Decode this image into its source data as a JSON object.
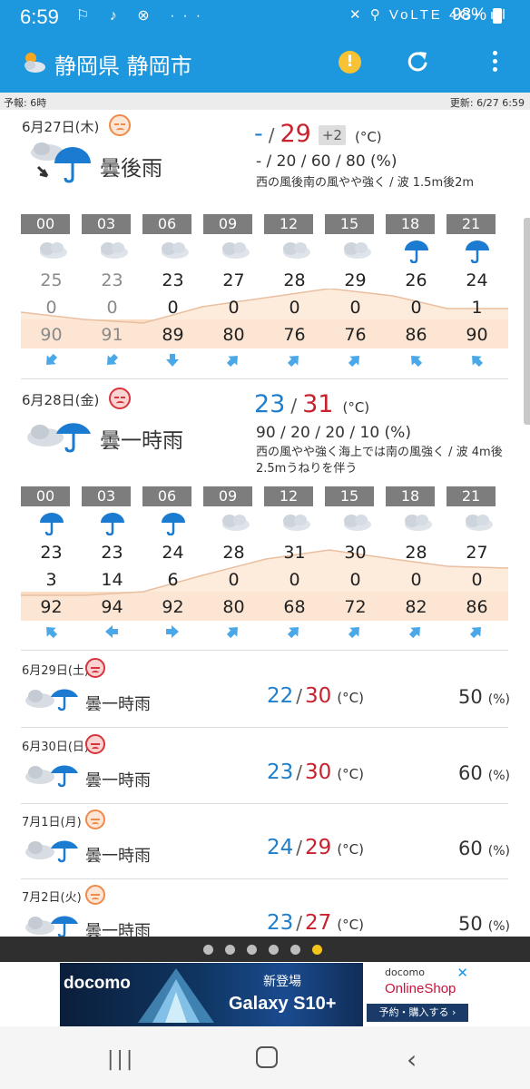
{
  "status_bar": {
    "time": "6:59",
    "icons_left": "⚐ ♪ ⊗ ···",
    "icons_right": "✕ ⚲ VoLTE 4G+ ıll",
    "battery": "98%"
  },
  "app_bar": {
    "title": "静岡県 静岡市",
    "alert_symbol": "!"
  },
  "info_strip": {
    "forecast": "予報: 6時",
    "updated": "更新: 6/27 6:59"
  },
  "days": [
    {
      "date": "6月27日(木)",
      "face": "orange",
      "weather": "曇後雨",
      "temp_min": "-",
      "temp_max": "29",
      "temp_diff": "+2",
      "unit": "(°C)",
      "precip": "- / 20 / 60 / 80 (%)",
      "wind": [
        "西の風後南の風やや強く / 波 1.5m後2m"
      ],
      "hours": [
        "00",
        "03",
        "06",
        "09",
        "12",
        "15",
        "18",
        "21"
      ],
      "icons": [
        "cloud",
        "cloud",
        "cloud",
        "cloud",
        "cloud",
        "cloud",
        "umbrella",
        "umbrella"
      ],
      "temps": [
        "25",
        "23",
        "23",
        "27",
        "28",
        "29",
        "26",
        "24"
      ],
      "temps_grey": [
        true,
        true,
        false,
        false,
        false,
        false,
        false,
        false
      ],
      "rain": [
        "0",
        "0",
        "0",
        "0",
        "0",
        "0",
        "0",
        "1"
      ],
      "rain_grey": [
        true,
        true,
        false,
        false,
        false,
        false,
        false,
        false
      ],
      "humidity": [
        "90",
        "91",
        "89",
        "80",
        "76",
        "76",
        "86",
        "90"
      ],
      "humidity_grey": [
        true,
        true,
        false,
        false,
        false,
        false,
        false,
        false
      ],
      "wind_dirs": [
        "sw",
        "sw",
        "s",
        "ne",
        "ne",
        "ne",
        "nw",
        "nw"
      ]
    },
    {
      "date": "6月28日(金)",
      "face": "red",
      "weather": "曇一時雨",
      "temp_min": "23",
      "temp_max": "31",
      "unit": "(°C)",
      "precip": "90 / 20 / 20 / 10 (%)",
      "wind": [
        "西の風やや強く海上では南の風強く / 波 4m後",
        "2.5mうねりを伴う"
      ],
      "hours": [
        "00",
        "03",
        "06",
        "09",
        "12",
        "15",
        "18",
        "21"
      ],
      "icons": [
        "umbrella",
        "umbrella",
        "umbrella",
        "cloud",
        "cloud",
        "cloud",
        "cloud",
        "cloud"
      ],
      "temps": [
        "23",
        "23",
        "24",
        "28",
        "31",
        "30",
        "28",
        "27"
      ],
      "rain": [
        "3",
        "14",
        "6",
        "0",
        "0",
        "0",
        "0",
        "0"
      ],
      "humidity": [
        "92",
        "94",
        "92",
        "80",
        "68",
        "72",
        "82",
        "86"
      ],
      "wind_dirs": [
        "nw",
        "w",
        "e",
        "ne",
        "ne",
        "ne",
        "ne",
        "ne"
      ]
    }
  ],
  "weekly": [
    {
      "date": "6月29日(土)",
      "face": "red",
      "weather": "曇一時雨",
      "min": "22",
      "max": "30",
      "unit": "(°C)",
      "pop": "50",
      "pop_unit": "(%)"
    },
    {
      "date": "6月30日(日)",
      "face": "red",
      "weather": "曇一時雨",
      "min": "23",
      "max": "30",
      "unit": "(°C)",
      "pop": "60",
      "pop_unit": "(%)"
    },
    {
      "date": "7月1日(月)",
      "face": "orange",
      "weather": "曇一時雨",
      "min": "24",
      "max": "29",
      "unit": "(°C)",
      "pop": "60",
      "pop_unit": "(%)"
    },
    {
      "date": "7月2日(火)",
      "face": "orange",
      "weather": "曇一時雨",
      "min": "23",
      "max": "27",
      "unit": "(°C)",
      "pop": "50",
      "pop_unit": "(%)"
    }
  ],
  "pager": {
    "count": 6,
    "active": 5
  },
  "ad": {
    "brand": "docomo",
    "new_label": "新登場",
    "model": "Galaxy S10+",
    "shop_brand": "docomo",
    "shop_name": "OnlineShop",
    "shop_button": "予約・購入する ›",
    "close": "✕"
  },
  "nav": {
    "recent": "|||",
    "back": "‹"
  },
  "colors": {
    "primary": "#1d97dd",
    "temp_min": "#1f7fcc",
    "temp_max": "#c8222e",
    "umbrella": "#1a7bd0",
    "humidity_band": "#f9dcc2",
    "pager_active": "#f3c51b"
  }
}
